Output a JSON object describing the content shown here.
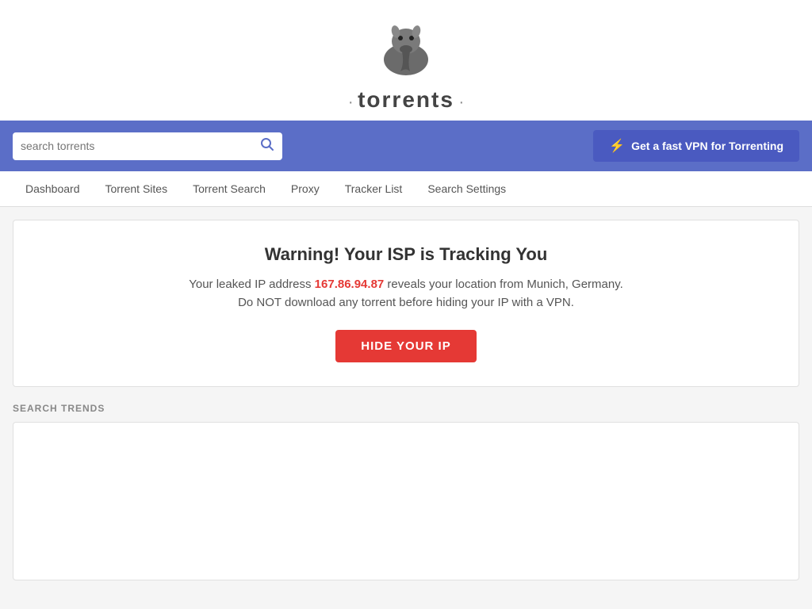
{
  "header": {
    "logo_text": "torrents",
    "logo_dots_left": "·",
    "logo_dots_right": "·"
  },
  "search_bar": {
    "placeholder": "search torrents",
    "vpn_button_label": "Get a fast VPN for Torrenting",
    "bolt_icon": "⚡"
  },
  "nav": {
    "items": [
      {
        "label": "Dashboard",
        "href": "#"
      },
      {
        "label": "Torrent Sites",
        "href": "#"
      },
      {
        "label": "Torrent Search",
        "href": "#"
      },
      {
        "label": "Proxy",
        "href": "#"
      },
      {
        "label": "Tracker List",
        "href": "#"
      },
      {
        "label": "Search Settings",
        "href": "#"
      }
    ]
  },
  "warning": {
    "title": "Warning! Your ISP is Tracking You",
    "line1_prefix": "Your leaked IP address ",
    "ip": "167.86.94.87",
    "line1_suffix": " reveals your location from Munich, Germany.",
    "line2": "Do NOT download any torrent before hiding your IP with a VPN.",
    "hide_ip_label": "HIDE YOUR IP"
  },
  "search_trends": {
    "label": "SEARCH TRENDS"
  },
  "icons": {
    "search": "🔍"
  }
}
